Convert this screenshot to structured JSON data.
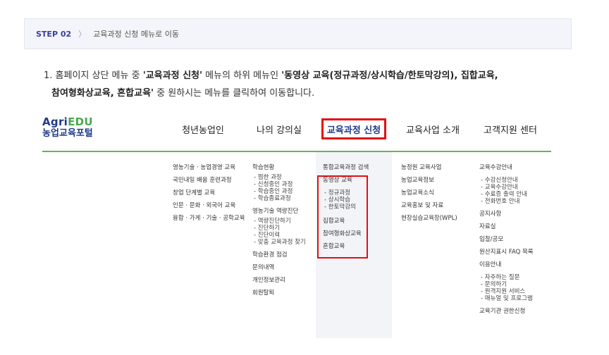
{
  "breadcrumb": {
    "step": "STEP 02",
    "separator": "〉",
    "title": "교육과정 신청 메뉴로 이동"
  },
  "instruction": {
    "l1a": "1. 홈페이지 상단 메뉴 중 ",
    "l1b": "'교육과정 신청'",
    "l1c": " 메뉴의 하위 메뉴인 ",
    "l1d": "'동영상 교육(정규과정/상시학습/한토막강의), 집합교육,",
    "l2a": "참여형화상교육, 혼합교육'",
    "l2b": " 중 원하시는 메뉴를 클릭하여 이동합니다."
  },
  "logo": {
    "agri": "Agri",
    "edu": "EDU",
    "sub": "농업교육포털"
  },
  "nav": [
    {
      "label": "청년농업인"
    },
    {
      "label": "나의 강의실"
    },
    {
      "label": "교육과정 신청"
    },
    {
      "label": "교육사업 소개"
    },
    {
      "label": "고객지원 센터"
    }
  ],
  "menus": {
    "youth": [
      "영농기술 · 농업경영 교육",
      "국민내일 배움 훈련과정",
      "창업 단계별 교육",
      "인문 · 문화 · 외국어 교육",
      "융합 · 가게 · 기술 · 공학교육"
    ],
    "mylecture": {
      "h1": "학습현황",
      "s1": [
        "- 찜한 과정",
        "- 신청중인 과정",
        "- 학습중인 과정",
        "- 학습종료과정"
      ],
      "h2": "영농기술 역량진단",
      "s2": [
        "- 역량진단하기",
        "- 진단하기",
        "- 진단이력",
        "- 맞춤 교육과정 찾기"
      ],
      "h3": "학습환경 점검",
      "h4": "문의내역",
      "h5": "개인정보관리",
      "h6": "회원탈퇴"
    },
    "apply": {
      "h1": "통합교육과정 검색",
      "h2": "동영상 교육",
      "s2": [
        "- 정규과정",
        "- 상시학습",
        "- 한토막강의"
      ],
      "h3": "집합교육",
      "h4": "참여형화상교육",
      "h5": "혼합교육"
    },
    "business": [
      "농정원 교육사업",
      "농업교육정보",
      "농업교육소식",
      "교육홍보 및 자료",
      "현장실습교육장(WPL)"
    ],
    "support": {
      "h1": "교육수강안내",
      "s1": [
        "- 수강신청안내",
        "- 교육수강안내",
        "- 수료증 출력 안내",
        "- 전화번호 안내"
      ],
      "h2": "공지사항",
      "h3": "자료실",
      "h4": "입찰/공모",
      "h5": "원산지표시 FAQ 목록",
      "h6": "이용안내",
      "s6": [
        "- 자주하는 질문",
        "- 문의하기",
        "- 원격지원 서비스",
        "- 매뉴얼 및 프로그램"
      ],
      "h7": "교육기관 권한신청"
    }
  },
  "colors": {
    "highlight": "#e20f14",
    "brand": "#1f3a87",
    "accent_green": "#6cb24f"
  }
}
